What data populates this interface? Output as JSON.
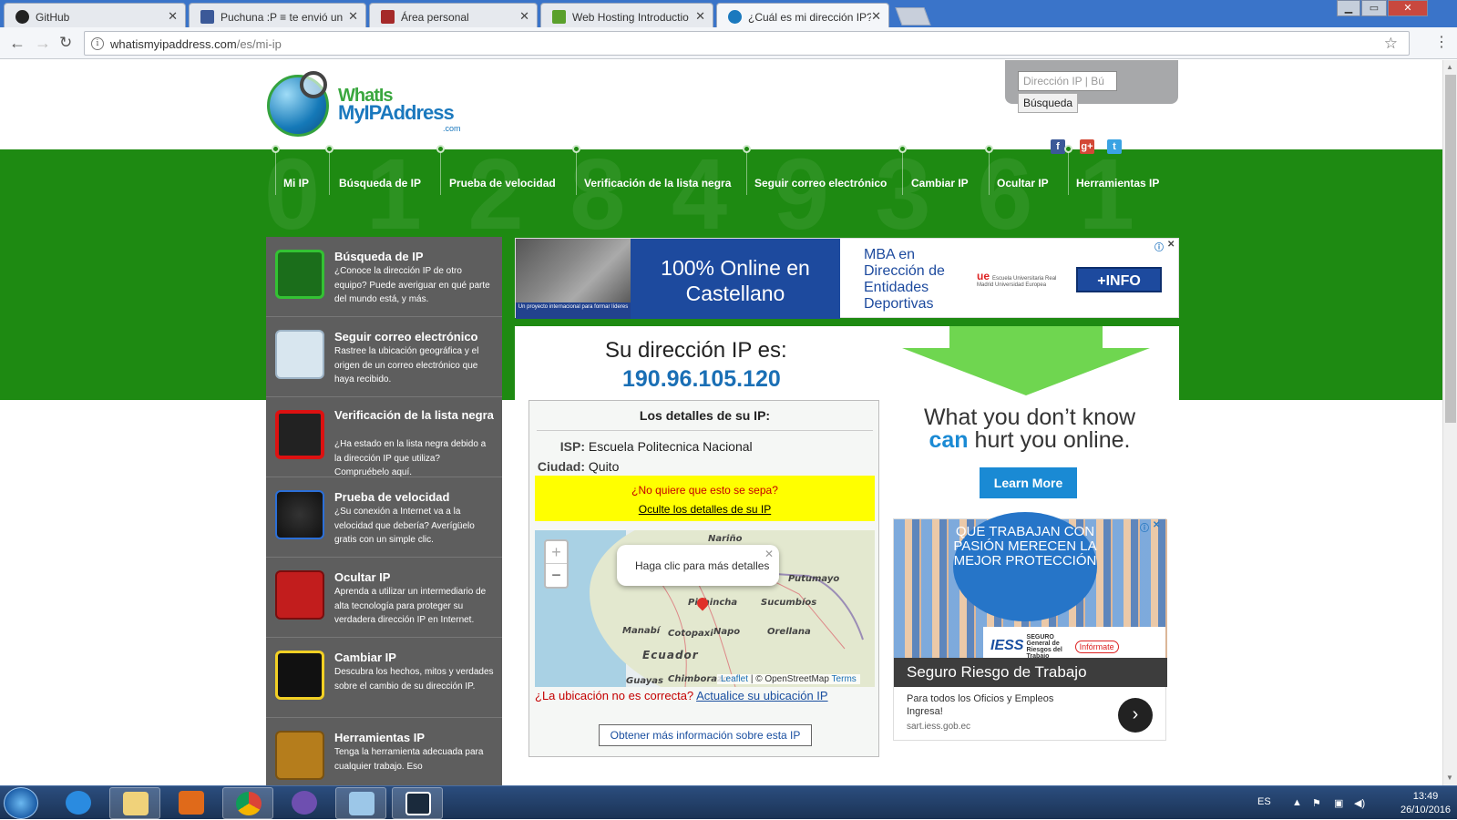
{
  "browser": {
    "tabs": [
      {
        "title": "GitHub",
        "icon": "github-icon",
        "color": "#222222"
      },
      {
        "title": "Puchuna :P ≡ te envió un",
        "icon": "facebook-icon",
        "color": "#3b5998"
      },
      {
        "title": "Área personal",
        "icon": "moodle-icon",
        "color": "#a52a2a"
      },
      {
        "title": "Web Hosting Introductio",
        "icon": "hosting-icon",
        "color": "#5aa02c"
      },
      {
        "title": "¿Cuál es mi dirección IP?",
        "icon": "globe-icon",
        "color": "#1b79be"
      }
    ],
    "url": {
      "host": "whatismyipaddress.com",
      "path": "/es/mi-ip"
    }
  },
  "header": {
    "logo": {
      "line1": "WhatIs",
      "line2": "MyIPAddress",
      "line3": ".com"
    },
    "search": {
      "placeholder": "Dirección IP | Bú",
      "button": "Búsqueda"
    },
    "social": [
      "facebook-icon",
      "google-plus-icon",
      "twitter-icon"
    ]
  },
  "nav": [
    "Mi IP",
    "Búsqueda de IP",
    "Prueba de velocidad",
    "Verificación de la lista negra",
    "Seguir correo electrónico",
    "Cambiar IP",
    "Ocultar IP",
    "Herramientas IP"
  ],
  "sidebar": [
    {
      "title": "Búsqueda de IP",
      "desc": "¿Conoce la dirección IP de otro equipo? Puede averiguar en qué parte del mundo está, y más."
    },
    {
      "title": "Seguir correo electrónico",
      "desc": "Rastree la ubicación geográfica y el origen de un correo electrónico que haya recibido."
    },
    {
      "title": "Verificación de la lista negra",
      "desc": "¿Ha estado en la lista negra debido a la dirección IP que utiliza? Compruébelo aquí."
    },
    {
      "title": "Prueba de velocidad",
      "desc": "¿Su conexión a Internet va a la velocidad que debería? Averígüelo gratis con un simple clic."
    },
    {
      "title": "Ocultar IP",
      "desc": "Aprenda a utilizar un intermediario de alta tecnología para proteger su verdadera dirección IP en Internet."
    },
    {
      "title": "Cambiar IP",
      "desc": "Descubra los hechos, mitos y verdades sobre el cambio de su dirección IP."
    },
    {
      "title": "Herramientas IP",
      "desc": "Tenga la herramienta adecuada para cualquier trabajo. Eso"
    }
  ],
  "ad_banner": {
    "photo_caption": "Un proyecto internacional para formar líderes",
    "headline": "100% Online en Castellano",
    "mba": "MBA en Dirección de Entidades Deportivas",
    "university": "Escuela Universitaria Real Madrid Universidad Europea",
    "cta": "+INFO"
  },
  "ip": {
    "heading": "Su dirección IP es:",
    "address": "190.96.105.120",
    "details_heading": "Los detalles de su IP:",
    "isp_label": "ISP:",
    "isp": "Escuela Politecnica Nacional",
    "city_label": "Ciudad:",
    "city": "Quito",
    "hide_q": "¿No quiere que esto se sepa?",
    "hide_link": "Oculte los detalles de su IP",
    "wrong_loc": "¿La ubicación no es correcta?",
    "update_link": "Actualice su ubicación IP",
    "more_button": "Obtener más información sobre esta IP"
  },
  "map": {
    "popup": "Haga clic para más detalles",
    "zoom_in": "+",
    "zoom_out": "−",
    "labels": [
      "Nariño",
      "Putumayo",
      "Pichincha",
      "Sucumbíos",
      "Manabí",
      "Cotopaxi",
      "Napo",
      "Orellana",
      "Ecuador",
      "Guayas",
      "Chimborazo"
    ],
    "attribution": {
      "leaflet": "Leaflet",
      "osm": "| © OpenStreetMap",
      "terms": "Terms"
    }
  },
  "ad_right": {
    "line1": "What you don’t know",
    "can": "can",
    "line2": "hurt you online.",
    "button": "Learn More"
  },
  "ad_iess": {
    "circle_text": "QUE TRABAJAN CON PASIÓN MERECEN LA MEJOR PROTECCIÓN",
    "logo": "IESS",
    "logo2": "SEGURO General de Riesgos del Trabajo",
    "informate": "Infórmate",
    "title": "Seguro Riesgo de Trabajo",
    "sub": "Para todos los Oficios y Empleos Ingresa!",
    "domain": "sart.iess.gob.ec"
  },
  "taskbar": {
    "lang": "ES",
    "time": "13:49",
    "date": "26/10/2016"
  }
}
